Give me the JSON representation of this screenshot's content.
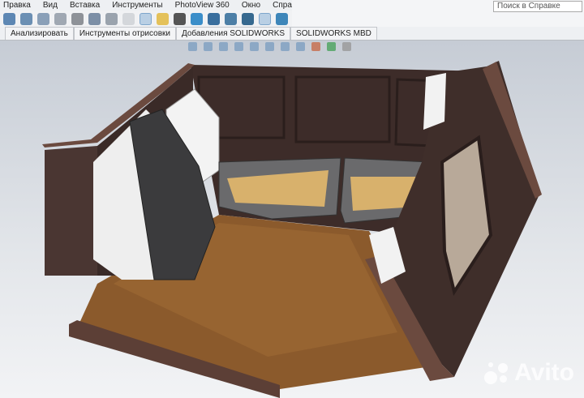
{
  "menu": {
    "items": [
      "Правка",
      "Вид",
      "Вставка",
      "Инструменты",
      "PhotoView 360",
      "Окно",
      "Справка"
    ]
  },
  "search": {
    "placeholder": "Поиск в Справке"
  },
  "tabs": [
    "Анализировать",
    "Инструменты отрисовки",
    "Добавления SOLIDWORKS",
    "SOLIDWORKS MBD"
  ],
  "watermark": "Avito",
  "colors": {
    "wall": "#3f2e2a",
    "wall_top": "#6b4a3f",
    "floor": "#8a5a2b",
    "panel": "#4a3834",
    "cabinet": "#3a3a3c"
  }
}
